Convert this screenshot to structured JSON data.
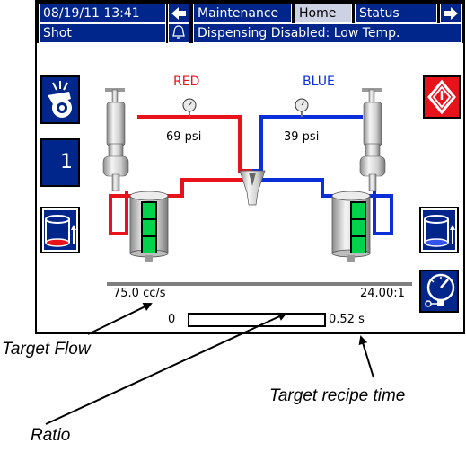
{
  "topbar": {
    "datetime": "08/19/11 13:41",
    "nav_left": "🡐",
    "tab_maintenance": "Maintenance",
    "tab_home": "Home",
    "tab_status": "Status",
    "nav_right": "🡒",
    "mode": "Shot",
    "alarm_message": "Dispensing Disabled: Low Temp."
  },
  "left_buttons": {
    "shot_number": "1"
  },
  "side_a": {
    "color_label": "RED",
    "pressure": "69 psi",
    "color": "#e8121b"
  },
  "side_b": {
    "color_label": "BLUE",
    "pressure": "39 psi",
    "color": "#0a2ed8"
  },
  "readouts": {
    "flow": "75.0 cc/s",
    "ratio": "24.00:1",
    "time_start": "0",
    "time_value": "0.52 s",
    "progress": 0
  },
  "annotations": {
    "target_flow": "Target Flow",
    "target_recipe_time": "Target recipe time",
    "ratio": "Ratio"
  }
}
